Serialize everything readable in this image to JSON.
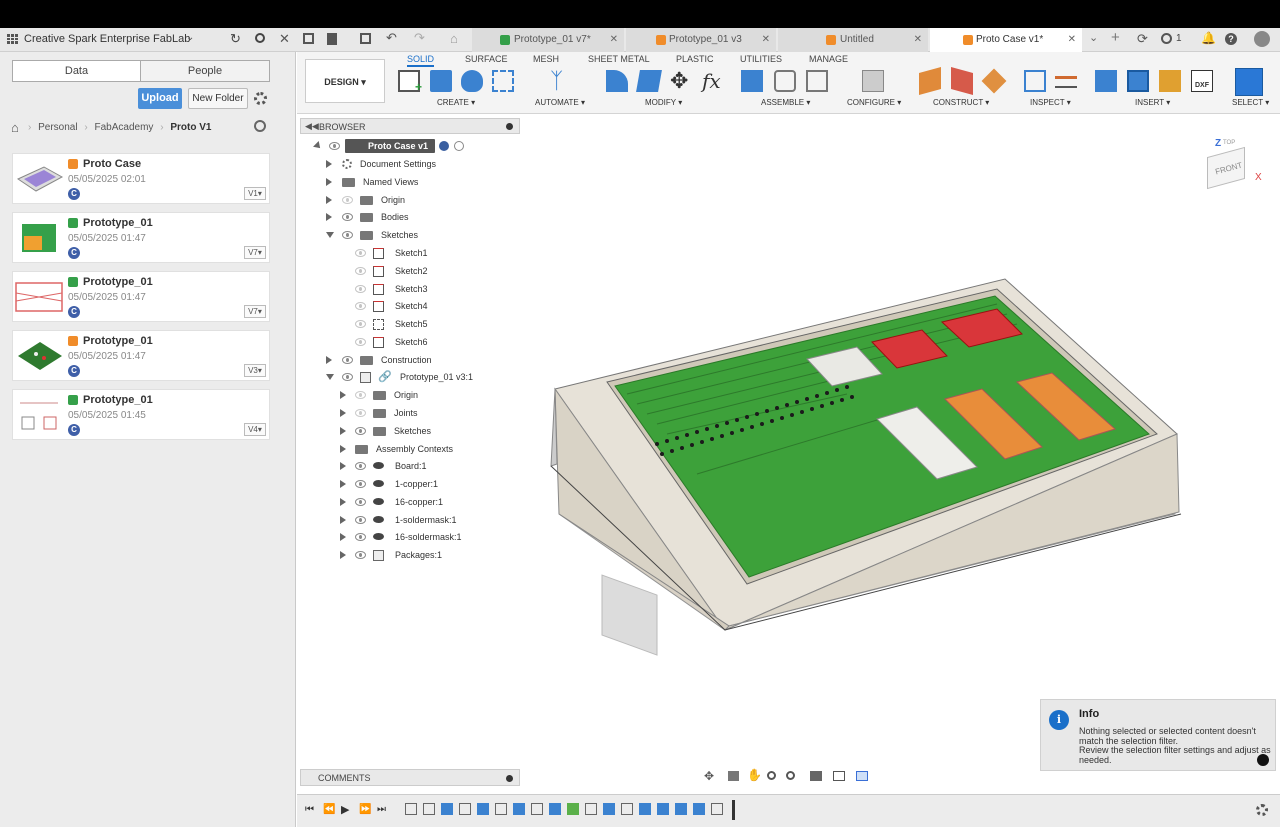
{
  "app": {
    "team": "Creative Spark Enterprise FabLab"
  },
  "tabs": [
    {
      "label": "Prototype_01 v7*"
    },
    {
      "label": "Prototype_01 v3"
    },
    {
      "label": "Untitled"
    },
    {
      "label": "Proto Case v1*"
    }
  ],
  "top_icons": {
    "jobs": "1"
  },
  "left": {
    "data_tab": "Data",
    "people_tab": "People",
    "upload": "Upload",
    "new_folder": "New Folder",
    "breadcrumb": [
      "Personal",
      "FabAcademy",
      "Proto V1"
    ],
    "files": [
      {
        "name": "Proto Case",
        "date": "05/05/2025 02:01",
        "version": "V1",
        "badge": "C",
        "color": "#f08c2a"
      },
      {
        "name": "Prototype_01",
        "date": "05/05/2025 01:47",
        "version": "V7",
        "badge": "C",
        "color": "#35a04a"
      },
      {
        "name": "Prototype_01",
        "date": "05/05/2025 01:47",
        "version": "V7",
        "badge": "C",
        "color": "#35a04a"
      },
      {
        "name": "Prototype_01",
        "date": "05/05/2025 01:47",
        "version": "V3",
        "badge": "C",
        "color": "#f08c2a"
      },
      {
        "name": "Prototype_01",
        "date": "05/05/2025 01:45",
        "version": "V4",
        "badge": "C",
        "color": "#35a04a"
      }
    ]
  },
  "ribbon": {
    "design": "DESIGN",
    "tabs": [
      "SOLID",
      "SURFACE",
      "MESH",
      "SHEET METAL",
      "PLASTIC",
      "UTILITIES",
      "MANAGE"
    ],
    "groups": [
      "CREATE",
      "AUTOMATE",
      "MODIFY",
      "ASSEMBLE",
      "CONFIGURE",
      "CONSTRUCT",
      "INSPECT",
      "INSERT",
      "SELECT"
    ]
  },
  "browser": {
    "title": "BROWSER",
    "root": "Proto Case v1",
    "items": [
      "Document Settings",
      "Named Views",
      "Origin",
      "Bodies",
      "Sketches",
      "Sketch1",
      "Sketch2",
      "Sketch3",
      "Sketch4",
      "Sketch5",
      "Sketch6",
      "Construction",
      "Prototype_01 v3:1",
      "Origin",
      "Joints",
      "Sketches",
      "Assembly Contexts",
      "Board:1",
      "1-copper:1",
      "16-copper:1",
      "1-soldermask:1",
      "16-soldermask:1",
      "Packages:1"
    ]
  },
  "viewcube": {
    "top": "Z",
    "top_label": "TOP",
    "front": "FRONT",
    "x": "X"
  },
  "comments": "COMMENTS",
  "info": {
    "title": "Info",
    "body1": "Nothing selected or selected content doesn't",
    "body2": "match the selection filter.",
    "body3": "Review the selection filter settings and adjust as",
    "body4": "needed."
  }
}
